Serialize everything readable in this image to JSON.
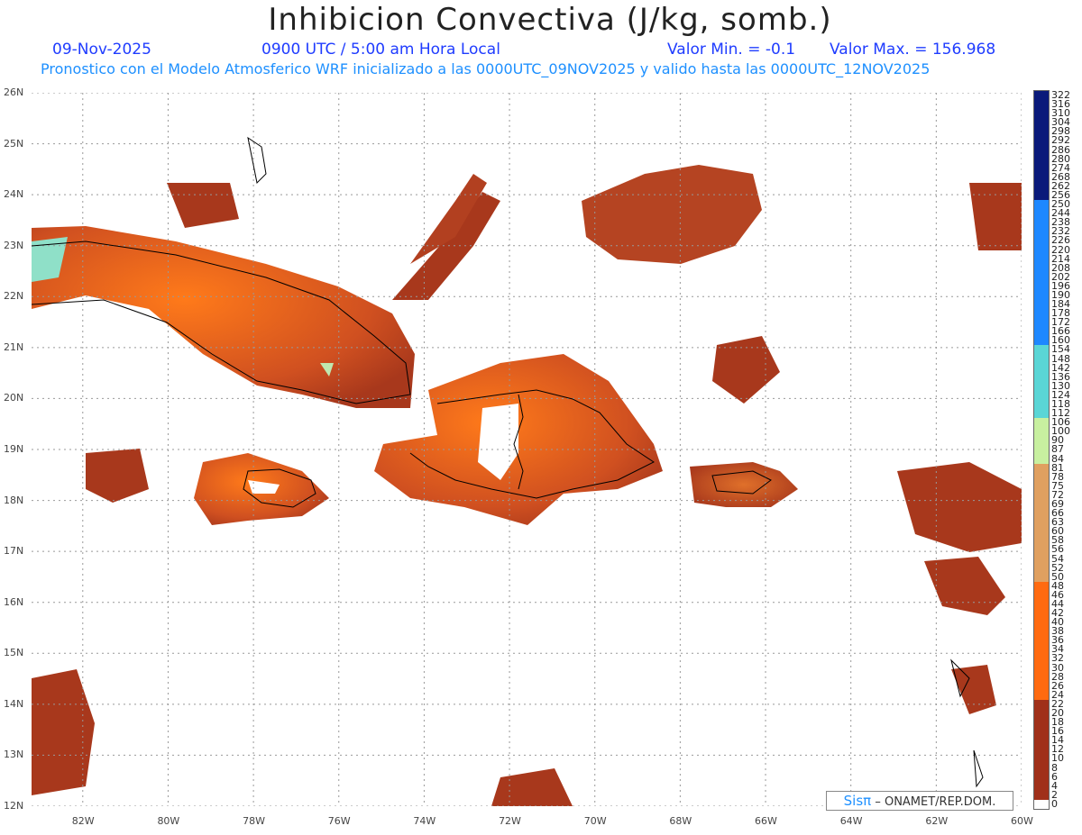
{
  "header": {
    "title": "Inhibicion Convectiva (J/kg, somb.)",
    "date": "09-Nov-2025",
    "time": "0900 UTC / 5:00 am Hora Local",
    "valmin": "Valor Min. = -0.1",
    "valmax": "Valor Max. = 156.968",
    "subtitle": "Pronostico con el Modelo Atmosferico WRF inicializado a las 0000UTC_09NOV2025 y valido hasta las  0000UTC_12NOV2025"
  },
  "map": {
    "lat_labels": [
      "26N",
      "25N",
      "24N",
      "23N",
      "22N",
      "21N",
      "20N",
      "19N",
      "18N",
      "17N",
      "16N",
      "15N",
      "14N",
      "13N",
      "12N"
    ],
    "lon_labels": [
      "82W",
      "80W",
      "78W",
      "76W",
      "74W",
      "72W",
      "70W",
      "68W",
      "66W",
      "64W",
      "62W",
      "60W"
    ],
    "lat_range": [
      12,
      26
    ],
    "lon_range": [
      -83.2,
      -60.0
    ],
    "grid": "dotted",
    "regions": [
      {
        "name": "Cuba",
        "lon": -79.0,
        "lat": 21.6
      },
      {
        "name": "Hispaniola",
        "lon": -71.8,
        "lat": 19.0
      },
      {
        "name": "Jamaica",
        "lon": -77.3,
        "lat": 18.1
      },
      {
        "name": "Puerto Rico",
        "lon": -66.4,
        "lat": 18.2
      },
      {
        "name": "Bahamas",
        "lon": -77.5,
        "lat": 24.5
      },
      {
        "name": "Lesser Antilles",
        "lon": -61.2,
        "lat": 15.5
      }
    ]
  },
  "legend": {
    "labels": [
      "322",
      "316",
      "310",
      "304",
      "298",
      "292",
      "286",
      "280",
      "274",
      "268",
      "262",
      "256",
      "250",
      "244",
      "238",
      "232",
      "226",
      "220",
      "214",
      "208",
      "202",
      "196",
      "190",
      "184",
      "178",
      "172",
      "166",
      "160",
      "154",
      "148",
      "142",
      "136",
      "130",
      "124",
      "118",
      "112",
      "106",
      "100",
      "90",
      "87",
      "84",
      "81",
      "78",
      "75",
      "72",
      "69",
      "66",
      "63",
      "60",
      "58",
      "56",
      "54",
      "52",
      "50",
      "48",
      "46",
      "44",
      "42",
      "40",
      "38",
      "36",
      "34",
      "32",
      "30",
      "28",
      "26",
      "24",
      "22",
      "20",
      "18",
      "16",
      "14",
      "12",
      "10",
      "8",
      "6",
      "4",
      "2",
      "0"
    ],
    "colors": {
      "high": "#0a1a7a",
      "mid_blue": "#1e88ff",
      "cyan": "#5ad6d6",
      "green": "#c8f0a0",
      "tan": "#e0a060",
      "orange": "#ff6a10",
      "red_brown": "#a0301a",
      "zero": "#ffffff"
    }
  },
  "credit": {
    "logo": "Sisπ",
    "text": "– ONAMET/REP.DOM."
  }
}
